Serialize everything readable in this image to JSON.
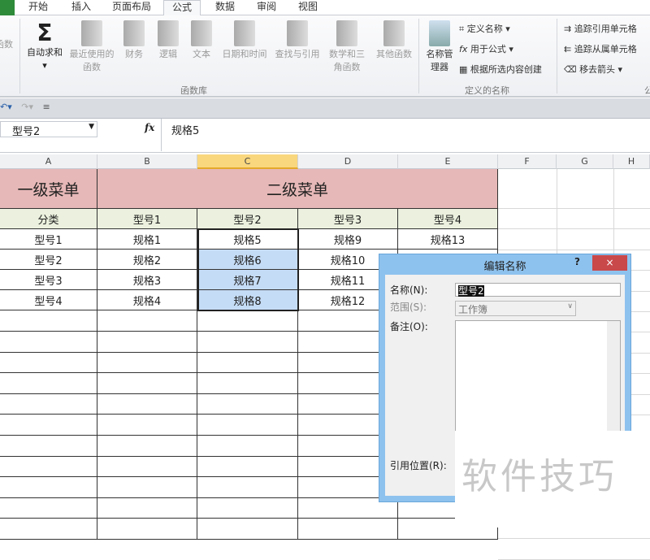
{
  "tabs": {
    "file": "",
    "items": [
      "开始",
      "插入",
      "页面布局",
      "公式",
      "数据",
      "审阅",
      "视图"
    ],
    "active": "公式"
  },
  "ribbon": {
    "function_library": {
      "items": [
        {
          "label": "函数",
          "icon": "insert-function-icon"
        },
        {
          "label": "自动求和",
          "icon": "sigma-icon"
        },
        {
          "label": "最近使用的函数",
          "icon": "book-icon"
        },
        {
          "label": "财务",
          "icon": "book-icon"
        },
        {
          "label": "逻辑",
          "icon": "book-question-icon"
        },
        {
          "label": "文本",
          "icon": "book-a-icon"
        },
        {
          "label": "日期和时间",
          "icon": "book-clock-icon"
        },
        {
          "label": "查找与引用",
          "icon": "book-search-icon"
        },
        {
          "label": "数学和三角函数",
          "icon": "book-theta-icon"
        },
        {
          "label": "其他函数",
          "icon": "books-icon"
        }
      ],
      "group_label": "函数库"
    },
    "defined_names": {
      "name_manager": "名称管理器",
      "define_name": "定义名称",
      "use_in_formula": "用于公式",
      "create_from_selection": "根据所选内容创建",
      "group_label": "定义的名称"
    },
    "auditing": {
      "trace_precedents": "追踪引用单元格",
      "trace_dependents": "追踪从属单元格",
      "remove_arrows": "移去箭头",
      "group_label_partial": "公"
    }
  },
  "formula_bar": {
    "name_box": "型号2",
    "fx": "fx",
    "value": "规格5"
  },
  "columns": [
    "A",
    "B",
    "C",
    "D",
    "E",
    "F",
    "G",
    "H"
  ],
  "selected_column": "C",
  "sheet": {
    "title_a": "一级菜单",
    "title_b": "二级菜单",
    "headers": [
      "分类",
      "型号1",
      "型号2",
      "型号3",
      "型号4"
    ],
    "rows": [
      [
        "型号1",
        "规格1",
        "规格5",
        "规格9",
        "规格13"
      ],
      [
        "型号2",
        "规格2",
        "规格6",
        "规格10",
        ""
      ],
      [
        "型号3",
        "规格3",
        "规格7",
        "规格11",
        ""
      ],
      [
        "型号4",
        "规格4",
        "规格8",
        "规格12",
        ""
      ]
    ]
  },
  "dialog": {
    "title": "编辑名称",
    "help": "?",
    "close": "×",
    "name_label": "名称(N):",
    "name_value": "型号2",
    "scope_label": "范围(S):",
    "scope_value": "工作簿",
    "comment_label": "备注(O):",
    "refers_to_label": "引用位置(R):"
  },
  "watermark": "软件技巧",
  "colors": {
    "title_fill": "#e6b8b7",
    "header_fill": "#ebf1de",
    "selection_fill": "#c5dcf6",
    "dialog_frame": "#8ec2ee",
    "close_button": "#c9484a"
  }
}
